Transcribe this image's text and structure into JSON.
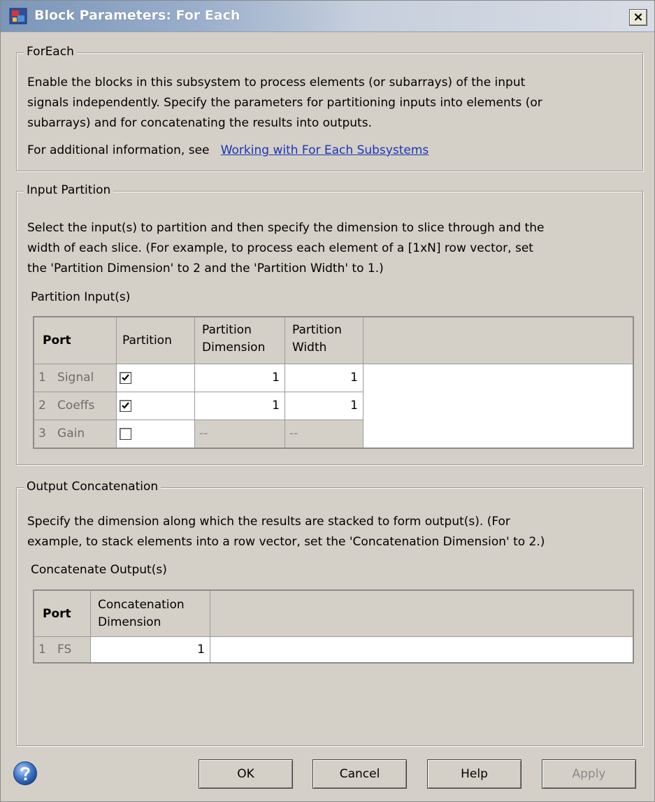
{
  "window": {
    "title": "Block Parameters: For Each",
    "close_label": "×"
  },
  "foreach": {
    "legend": "ForEach",
    "description_lines": [
      "Enable the blocks in this subsystem to process elements (or subarrays) of the input",
      "signals independently. Specify the parameters for partitioning inputs into elements (or",
      "subarrays) and for concatenating the results into outputs."
    ],
    "info_prefix": "For additional information, see",
    "info_link": "Working with For Each Subsystems"
  },
  "input_partition": {
    "legend": "Input Partition",
    "description_lines": [
      "Select the input(s) to partition and then specify the dimension to slice through and the",
      "width of each slice. (For example, to process each element of a [1xN] row vector, set",
      "the 'Partition Dimension' to 2 and the 'Partition Width' to 1.)"
    ],
    "table_label": "Partition Input(s)",
    "columns": {
      "port": "Port",
      "partition": "Partition",
      "dimension_l1": "Partition",
      "dimension_l2": "Dimension",
      "width_l1": "Partition",
      "width_l2": "Width"
    },
    "rows": [
      {
        "index": "1",
        "name": "Signal",
        "checked": true,
        "dimension": "1",
        "width": "1"
      },
      {
        "index": "2",
        "name": "Coeffs",
        "checked": true,
        "dimension": "1",
        "width": "1"
      },
      {
        "index": "3",
        "name": "Gain",
        "checked": false,
        "dimension": "--",
        "width": "--"
      }
    ]
  },
  "output_concatenation": {
    "legend": "Output Concatenation",
    "description_lines": [
      "Specify the dimension along which the results are stacked to form output(s). (For",
      "example, to stack elements into a row vector, set the 'Concatenation Dimension' to 2.)"
    ],
    "table_label": "Concatenate Output(s)",
    "columns": {
      "port": "Port",
      "dimension_l1": "Concatenation",
      "dimension_l2": "Dimension"
    },
    "rows": [
      {
        "index": "1",
        "name": "FS",
        "dimension": "1"
      }
    ]
  },
  "buttons": {
    "ok": "OK",
    "cancel": "Cancel",
    "help": "Help",
    "apply": "Apply"
  },
  "icons": {
    "app": "simulink-block-icon",
    "help": "help-question-icon"
  }
}
